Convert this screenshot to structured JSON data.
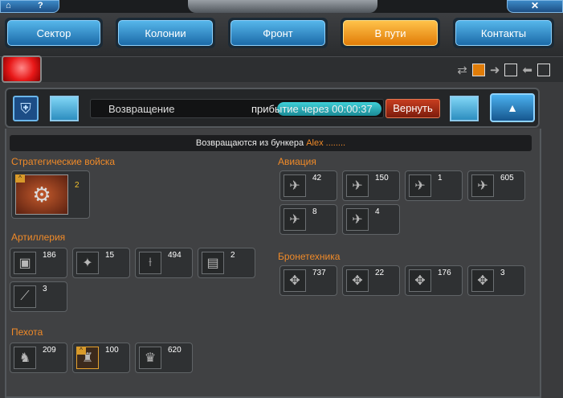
{
  "topbar": {
    "left_icons": [
      "home-icon",
      "help-icon"
    ],
    "help_label": "?",
    "right_icon": "close-icon",
    "close_label": "✕"
  },
  "nav": {
    "tabs": [
      {
        "label": "Сектор",
        "active": false
      },
      {
        "label": "Колонии",
        "active": false
      },
      {
        "label": "Фронт",
        "active": false
      },
      {
        "label": "В пути",
        "active": true
      },
      {
        "label": "Контакты",
        "active": false
      }
    ]
  },
  "toolbar": {
    "icons": [
      "alert-icon",
      "swap-icon",
      "arrow-right-icon",
      "arrow-left-icon"
    ]
  },
  "status": {
    "label": "Возвращение",
    "eta_label": "прибытие через 00:00:37",
    "revert_label": "Вернуть"
  },
  "subheader": {
    "text": "Возвращаются из бункера",
    "name": "Alex ........"
  },
  "sections": {
    "strategic": {
      "title": "Стратегические войска",
      "units": [
        {
          "count": "2"
        }
      ]
    },
    "artillery": {
      "title": "Артиллерия",
      "units": [
        {
          "count": "186"
        },
        {
          "count": "15"
        },
        {
          "count": "494"
        },
        {
          "count": "2"
        },
        {
          "count": "3"
        }
      ]
    },
    "infantry": {
      "title": "Пехота",
      "units": [
        {
          "count": "209"
        },
        {
          "count": "100"
        },
        {
          "count": "620"
        }
      ]
    },
    "aviation": {
      "title": "Авиация",
      "units": [
        {
          "count": "42"
        },
        {
          "count": "150"
        },
        {
          "count": "1"
        },
        {
          "count": "605"
        },
        {
          "count": "8"
        },
        {
          "count": "4"
        }
      ]
    },
    "armor": {
      "title": "Бронетехника",
      "units": [
        {
          "count": "737"
        },
        {
          "count": "22"
        },
        {
          "count": "176"
        },
        {
          "count": "3"
        }
      ]
    }
  },
  "colors": {
    "accent": "#f08a28",
    "tab_blue": "#3a9bd6",
    "tab_active": "#f0a020",
    "revert": "#b0321a"
  }
}
